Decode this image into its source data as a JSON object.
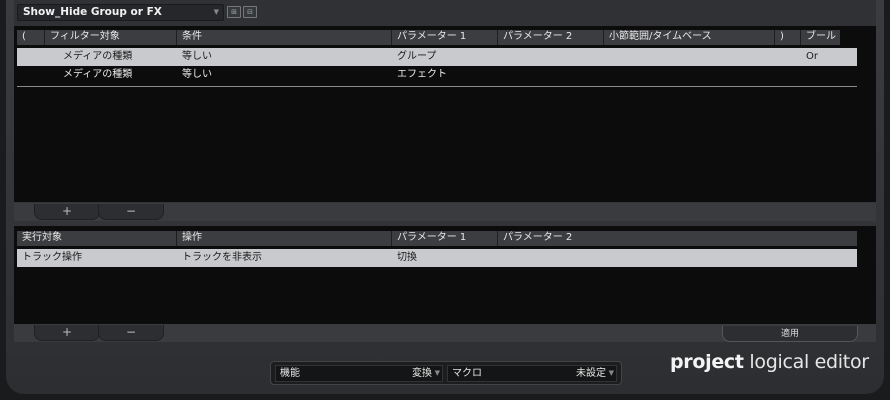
{
  "preset": {
    "name": "Show_Hide Group or FX"
  },
  "filter_table": {
    "columns": [
      "(",
      "フィルター対象",
      "条件",
      "パラメーター 1",
      "パラメーター 2",
      "小節範囲/タイムベース",
      ")",
      "ブール"
    ],
    "rows": [
      {
        "paren_open": "",
        "target": "メディアの種類",
        "condition": "等しい",
        "param1": "グループ",
        "param2": "",
        "range": "",
        "paren_close": "",
        "bool": "Or"
      },
      {
        "paren_open": "",
        "target": "メディアの種類",
        "condition": "等しい",
        "param1": "エフェクト",
        "param2": "",
        "range": "",
        "paren_close": "",
        "bool": ""
      }
    ]
  },
  "filter_buttons": {
    "add": "+",
    "remove": "−"
  },
  "action_table": {
    "columns": [
      "実行対象",
      "操作",
      "パラメーター 1",
      "パラメーター 2"
    ],
    "rows": [
      {
        "target": "トラック操作",
        "operation": "トラックを非表示",
        "param1": "切換",
        "param2": ""
      }
    ]
  },
  "action_buttons": {
    "add": "+",
    "remove": "−",
    "apply": "適用"
  },
  "bottom": {
    "function_label": "機能",
    "function_value": "変換",
    "macro_label": "マクロ",
    "macro_value": "未設定"
  },
  "brand": {
    "bold": "project",
    "rest": " logical editor"
  }
}
